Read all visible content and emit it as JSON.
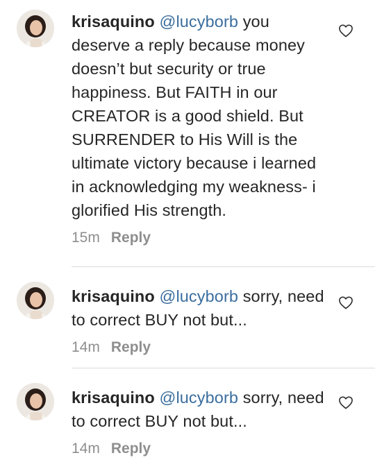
{
  "comments": [
    {
      "username": "krisaquino",
      "mention": "@lucyborb",
      "text": " you deserve a reply because money doesn’t but security or true happiness. But FAITH in our CREATOR is a good shield. But SURRENDER to His Will is the ultimate victory because i learned in acknowledging my weakness- i glorified His strength.",
      "time": "15m",
      "reply_label": "Reply"
    },
    {
      "username": "krisaquino",
      "mention": "@lucyborb",
      "text": " sorry, need to correct BUY not but...",
      "time": "14m",
      "reply_label": "Reply"
    },
    {
      "username": "krisaquino",
      "mention": "@lucyborb",
      "text": " sorry, need to correct BUY not but...",
      "time": "14m",
      "reply_label": "Reply"
    }
  ],
  "icons": {
    "like": "heart-outline-icon",
    "avatar": "profile-photo"
  },
  "colors": {
    "text": "#262626",
    "mention": "#3b6e9e",
    "meta": "#8e8e8e",
    "divider": "#dbdbdb"
  }
}
